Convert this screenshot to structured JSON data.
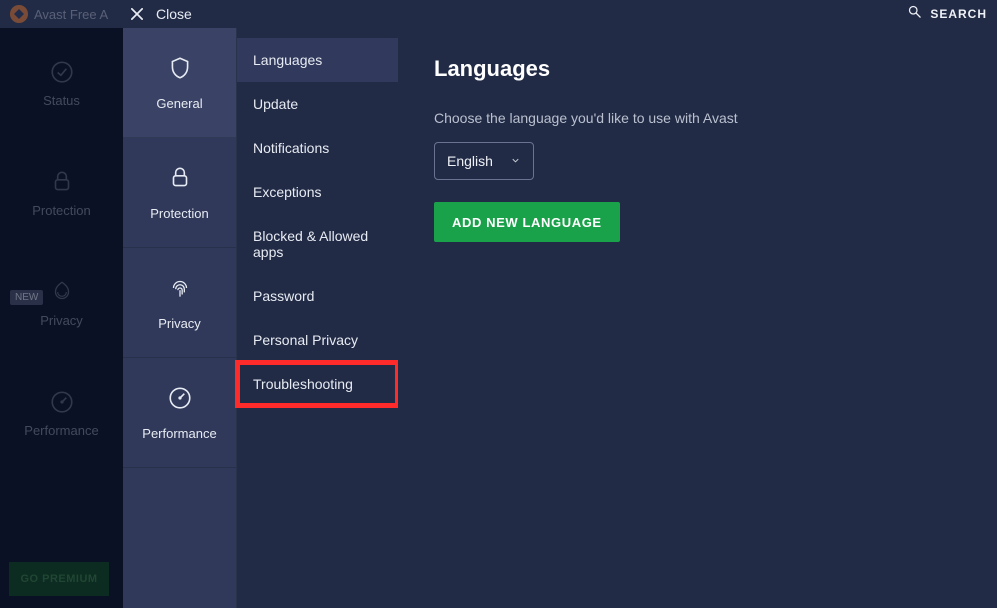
{
  "header": {
    "app_title": "Avast Free A",
    "close_label": "Close",
    "search_label": "SEARCH"
  },
  "main_nav": {
    "status": "Status",
    "protection": "Protection",
    "privacy": "Privacy",
    "performance": "Performance",
    "new_badge": "NEW",
    "go_premium": "GO PREMIUM"
  },
  "settings": {
    "categories": {
      "general": "General",
      "protection": "Protection",
      "privacy": "Privacy",
      "performance": "Performance"
    },
    "subnav": {
      "languages": "Languages",
      "update": "Update",
      "notifications": "Notifications",
      "exceptions": "Exceptions",
      "blocked_allowed": "Blocked & Allowed apps",
      "password": "Password",
      "personal_privacy": "Personal Privacy",
      "troubleshooting": "Troubleshooting"
    },
    "content": {
      "title": "Languages",
      "description": "Choose the language you'd like to use with Avast",
      "selected_language": "English",
      "add_language_btn": "ADD NEW LANGUAGE"
    }
  }
}
